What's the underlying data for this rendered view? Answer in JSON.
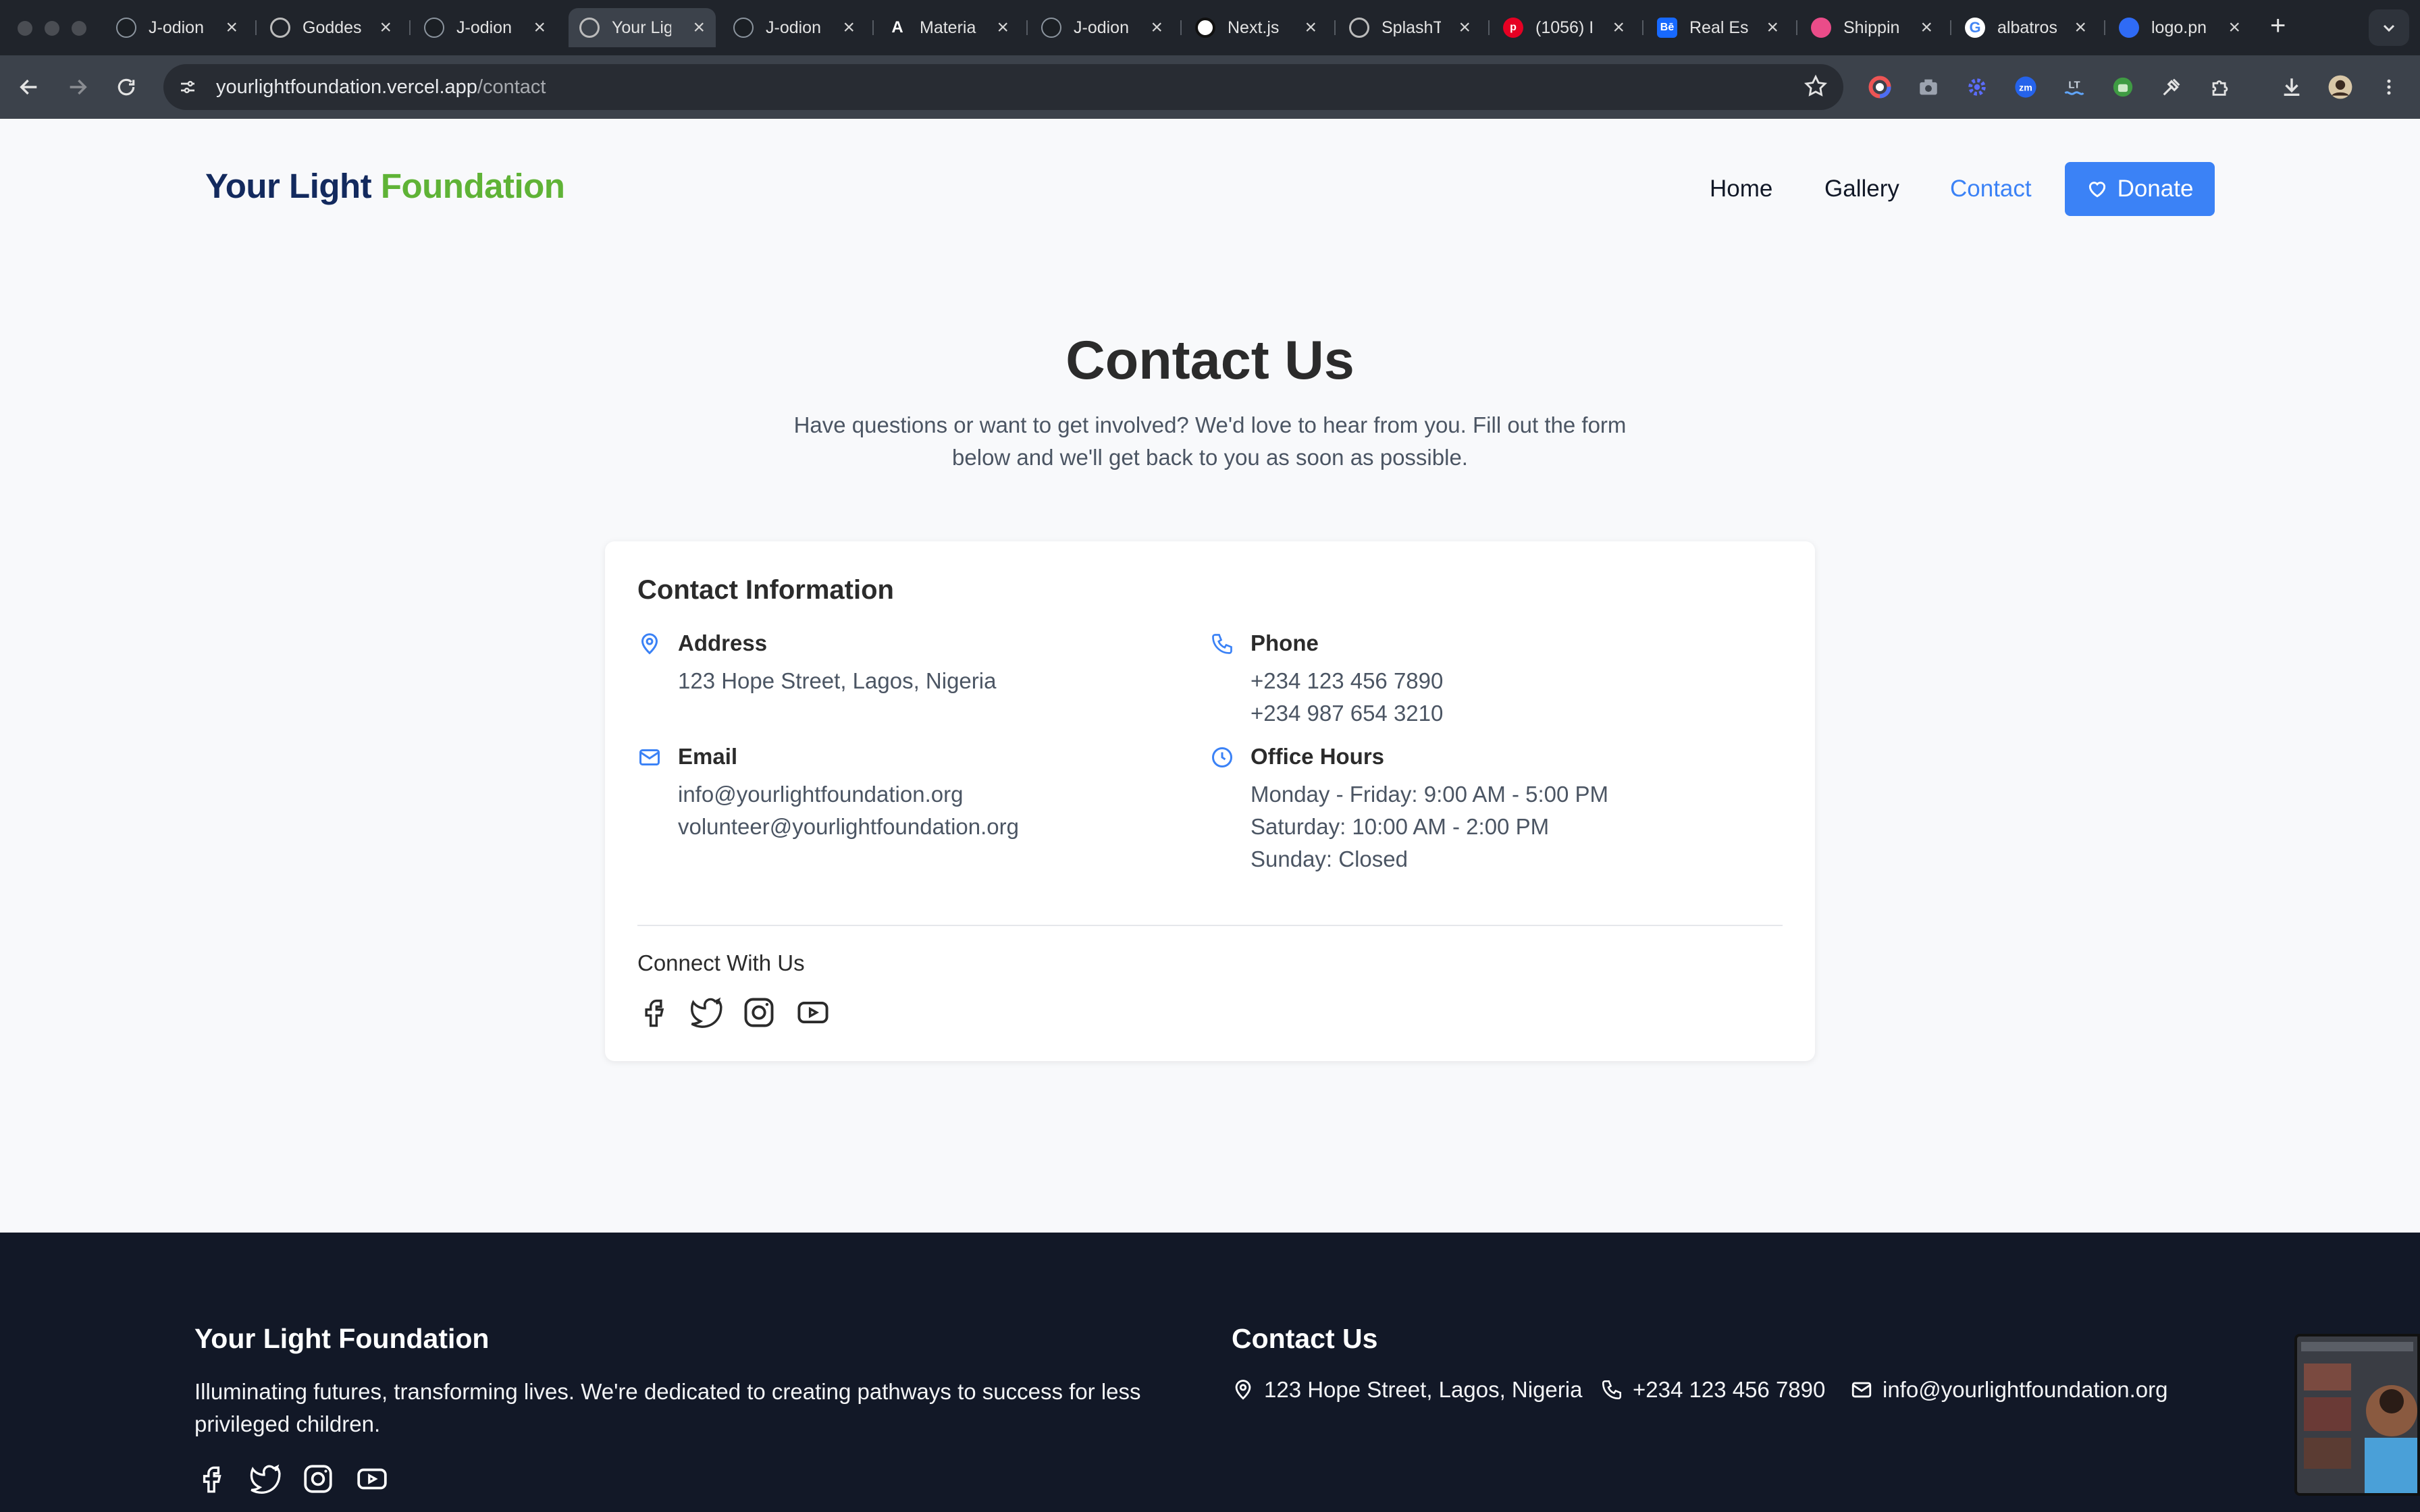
{
  "browser": {
    "tabs": [
      {
        "label": "J-odion",
        "favicon": "github-icon",
        "active": false
      },
      {
        "label": "Goddes",
        "favicon": "globe-icon",
        "active": false
      },
      {
        "label": "J-odion",
        "favicon": "github-icon",
        "active": false
      },
      {
        "label": "Your Lig",
        "favicon": "globe-icon",
        "active": true
      },
      {
        "label": "J-odion",
        "favicon": "github-icon",
        "active": false
      },
      {
        "label": "Materia",
        "favicon": "material-icon",
        "active": false
      },
      {
        "label": "J-odion",
        "favicon": "github-icon",
        "active": false
      },
      {
        "label": "Next.js",
        "favicon": "openai-icon",
        "active": false
      },
      {
        "label": "SplashT",
        "favicon": "globe-icon",
        "active": false
      },
      {
        "label": "(1056) I",
        "favicon": "pinterest-icon",
        "active": false
      },
      {
        "label": "Real Es",
        "favicon": "behance-icon",
        "active": false
      },
      {
        "label": "Shippin",
        "favicon": "dribbble-icon",
        "active": false
      },
      {
        "label": "albatros",
        "favicon": "google-icon",
        "active": false
      },
      {
        "label": "logo.pn",
        "favicon": "edit-icon",
        "active": false
      }
    ],
    "url_host": "yourlightfoundation.vercel.app",
    "url_path": "/contact"
  },
  "header": {
    "logo_part1": "Your Light",
    "logo_part2": "Foundation",
    "nav": [
      "Home",
      "Gallery",
      "Contact"
    ],
    "active_nav": "Contact",
    "donate_label": "Donate"
  },
  "hero": {
    "title": "Contact Us",
    "lead_line1": "Have questions or want to get involved? We'd love to hear from you. Fill out the form",
    "lead_line2": "below and we'll get back to you as soon as possible."
  },
  "contact_card": {
    "title": "Contact Information",
    "address_label": "Address",
    "address_value": "123 Hope Street, Lagos, Nigeria",
    "phone_label": "Phone",
    "phone_values": [
      "+234 123 456 7890",
      "+234 987 654 3210"
    ],
    "email_label": "Email",
    "email_values": [
      "info@yourlightfoundation.org",
      "volunteer@yourlightfoundation.org"
    ],
    "hours_label": "Office Hours",
    "hours_values": [
      "Monday - Friday: 9:00 AM - 5:00 PM",
      "Saturday: 10:00 AM - 2:00 PM",
      "Sunday: Closed"
    ],
    "connect_label": "Connect With Us",
    "social_icons": [
      "facebook-icon",
      "twitter-icon",
      "instagram-icon",
      "youtube-icon"
    ]
  },
  "footer": {
    "brand_title": "Your Light Foundation",
    "desc_line1": "Illuminating futures, transforming lives. We're dedicated to creating pathways to success for less",
    "desc_line2": "privileged children.",
    "contact_title": "Contact Us",
    "address": "123 Hope Street, Lagos, Nigeria",
    "phone": "+234 123 456 7890",
    "email": "info@yourlightfoundation.org"
  },
  "colors": {
    "brand_navy": "#132a5e",
    "brand_green": "#5fb336",
    "accent_blue": "#3b82f6",
    "footer_bg": "#121827"
  }
}
